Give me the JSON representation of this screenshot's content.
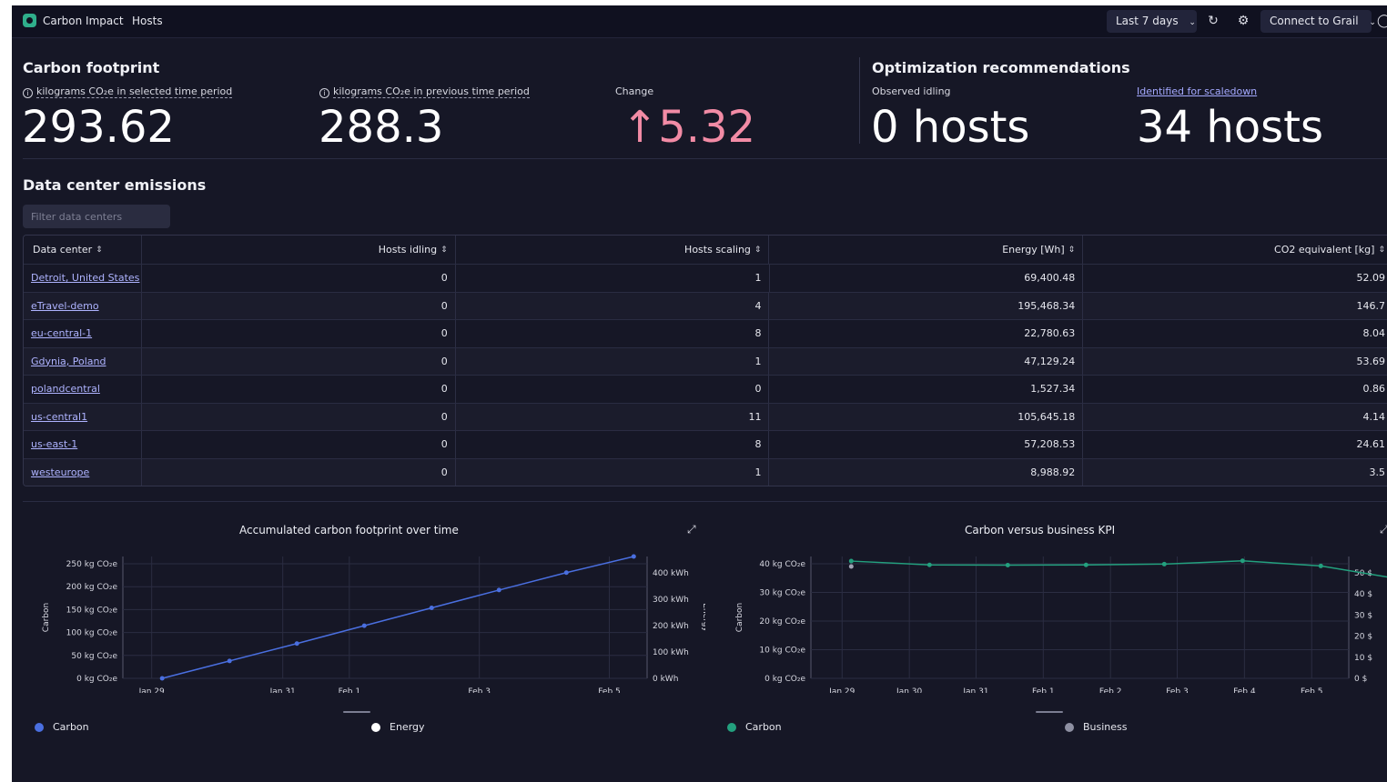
{
  "topbar": {
    "app_name": "Carbon Impact",
    "nav_hosts": "Hosts",
    "timeframe": "Last 7 days",
    "connect": "Connect to Grail"
  },
  "footprint": {
    "title": "Carbon footprint",
    "selected_label": "kilograms CO₂e in selected time period",
    "selected_value": "293.62",
    "previous_label": "kilograms CO₂e in previous time period",
    "previous_value": "288.3",
    "change_label": "Change",
    "change_value": "5.32",
    "change_arrow": "↑"
  },
  "optimization": {
    "title": "Optimization recommendations",
    "idling_label": "Observed idling",
    "idling_value": "0 hosts",
    "scaledown_label": "Identified for scaledown",
    "scaledown_value": "34 hosts"
  },
  "emissions": {
    "title": "Data center emissions",
    "filter_placeholder": "Filter data centers",
    "columns": [
      "Data center",
      "Hosts idling",
      "Hosts scaling",
      "Energy [Wh]",
      "CO2 equivalent [kg]"
    ],
    "rows": [
      [
        "Detroit, United States",
        "0",
        "1",
        "69,400.48",
        "52.09"
      ],
      [
        "eTravel-demo",
        "0",
        "4",
        "195,468.34",
        "146.7"
      ],
      [
        "eu-central-1",
        "0",
        "8",
        "22,780.63",
        "8.04"
      ],
      [
        "Gdynia, Poland",
        "0",
        "1",
        "47,129.24",
        "53.69"
      ],
      [
        "polandcentral",
        "0",
        "0",
        "1,527.34",
        "0.86"
      ],
      [
        "us-central1",
        "0",
        "11",
        "105,645.18",
        "4.14"
      ],
      [
        "us-east-1",
        "0",
        "8",
        "57,208.53",
        "24.61"
      ],
      [
        "westeurope",
        "0",
        "1",
        "8,988.92",
        "3.5"
      ]
    ]
  },
  "chart_data": [
    {
      "type": "line",
      "title": "Accumulated carbon footprint over time",
      "ylabel": "Carbon",
      "y2label": "Energy",
      "x_ticks": [
        "Jan 29",
        "Jan 31",
        "Feb 1",
        "Feb 3",
        "Feb 5"
      ],
      "y_ticks": [
        "0 kg CO₂e",
        "50 kg CO₂e",
        "100 kg CO₂e",
        "150 kg CO₂e",
        "200 kg CO₂e",
        "250 kg CO₂e"
      ],
      "y2_ticks": [
        "0 kWh",
        "100 kWh",
        "200 kWh",
        "300 kWh",
        "400 kWh"
      ],
      "x": [
        "Jan 29",
        "Jan 30",
        "Jan 31",
        "Feb 1",
        "Feb 2",
        "Feb 3",
        "Feb 4",
        "Feb 5"
      ],
      "series": [
        {
          "name": "Carbon",
          "color": "#4a6fe0",
          "values": [
            0,
            42,
            84,
            127,
            170,
            213,
            255,
            294
          ]
        }
      ],
      "ylim": [
        0,
        294
      ],
      "legend": [
        "Carbon",
        "Energy"
      ],
      "legend_position": "bottom"
    },
    {
      "type": "line",
      "title": "Carbon versus business KPI",
      "ylabel": "Carbon",
      "x_ticks": [
        "Jan 29",
        "Jan 30",
        "Jan 31",
        "Feb 1",
        "Feb 2",
        "Feb 3",
        "Feb 4",
        "Feb 5"
      ],
      "y_ticks": [
        "0 kg CO₂e",
        "10 kg CO₂e",
        "20 kg CO₂e",
        "30 kg CO₂e",
        "40 kg CO₂e"
      ],
      "y2_ticks": [
        "0 $",
        "10 $",
        "20 $",
        "30 $",
        "40 $",
        "50 $"
      ],
      "x": [
        "Jan 29",
        "Jan 30",
        "Jan 31",
        "Feb 1",
        "Feb 2",
        "Feb 3",
        "Feb 4",
        "Feb 5"
      ],
      "series": [
        {
          "name": "Carbon",
          "color": "#23a07e",
          "values": [
            43.3,
            41.9,
            41.8,
            41.9,
            42.2,
            43.4,
            41.5,
            36.7
          ]
        },
        {
          "name": "Business",
          "color": "#a0a2b3",
          "values": [
            41.3
          ]
        }
      ],
      "ylim": [
        0,
        45
      ],
      "legend": [
        "Carbon",
        "Business"
      ],
      "legend_position": "bottom"
    }
  ]
}
